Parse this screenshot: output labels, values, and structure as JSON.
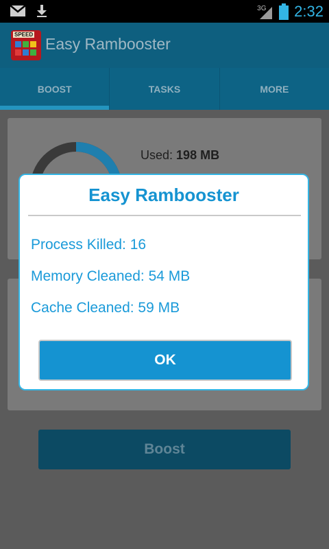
{
  "status_bar": {
    "time": "2:32",
    "network_label": "3G",
    "icons": [
      "gmail-icon",
      "download-icon",
      "signal-icon",
      "battery-icon"
    ]
  },
  "app": {
    "title": "Easy Rambooster",
    "icon_label": "SPEED"
  },
  "tabs": [
    {
      "label": "BOOST",
      "active": true
    },
    {
      "label": "TASKS",
      "active": false
    },
    {
      "label": "MORE",
      "active": false
    }
  ],
  "memory": {
    "used_label": "Used:",
    "used_value": "198 MB"
  },
  "boost_button": {
    "label": "Boost"
  },
  "dialog": {
    "title": "Easy Rambooster",
    "lines": [
      "Process Killed: 16",
      "Memory Cleaned: 54 MB",
      "Cache Cleaned: 59 MB"
    ],
    "ok_label": "OK"
  },
  "colors": {
    "accent": "#33b5e5",
    "dialog_text": "#1593d1",
    "action_bar": "#0e5f7f"
  }
}
